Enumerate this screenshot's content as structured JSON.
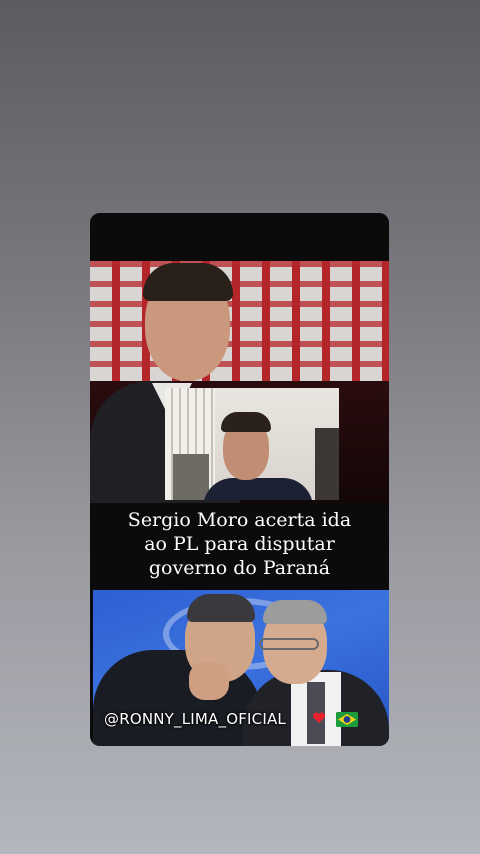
{
  "post": {
    "headline": "Sergio Moro acerta ida\nao PL para disputar\ngoverno do Paraná",
    "watermark": "@RONNY_LIMA_OFICIAL"
  },
  "colors": {
    "page_bg": "#7a7b80",
    "card_bg": "#0b0b0c",
    "headline_text": "#ffffff",
    "sign_red": "#b5262b",
    "bottom_photo_blue": "#3c72e0"
  },
  "icons": {
    "heart": "red-heart-icon",
    "flag": "brazil-flag-icon"
  }
}
